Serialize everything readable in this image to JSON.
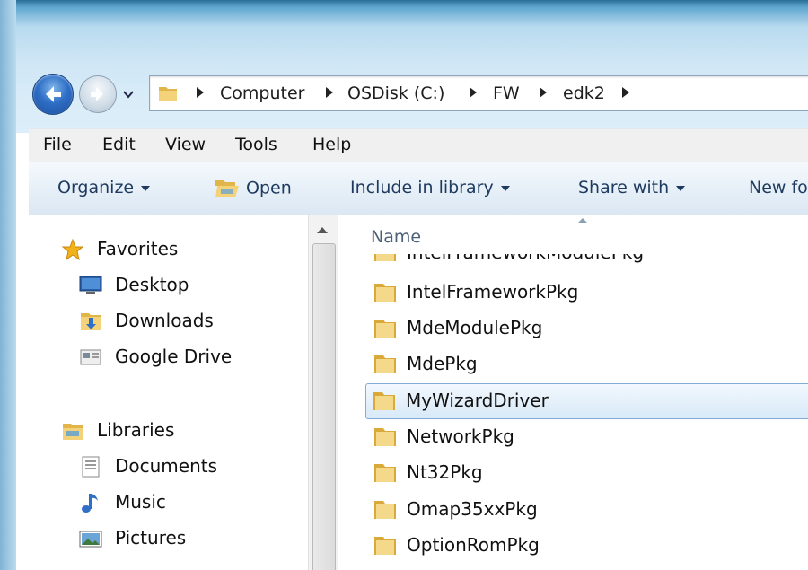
{
  "address": {
    "crumbs": [
      "Computer",
      "OSDisk (C:)",
      "FW",
      "edk2"
    ]
  },
  "menubar": {
    "items": [
      "File",
      "Edit",
      "View",
      "Tools",
      "Help"
    ]
  },
  "toolbar": {
    "organize": "Organize",
    "open": "Open",
    "include": "Include in library",
    "share": "Share with",
    "newfolder": "New fo"
  },
  "nav": {
    "favorites": "Favorites",
    "desktop": "Desktop",
    "downloads": "Downloads",
    "gdrive": "Google Drive",
    "libraries": "Libraries",
    "documents": "Documents",
    "music": "Music",
    "pictures": "Pictures"
  },
  "content": {
    "column_name": "Name",
    "rows": [
      "IntelFrameworkModulePkg",
      "IntelFrameworkPkg",
      "MdeModulePkg",
      "MdePkg",
      "MyWizardDriver",
      "NetworkPkg",
      "Nt32Pkg",
      "Omap35xxPkg",
      "OptionRomPkg"
    ],
    "selected": "MyWizardDriver"
  },
  "colors": {
    "accent": "#3a78c2",
    "selection": "#d8e9f8",
    "folder": "#e8c25a"
  }
}
